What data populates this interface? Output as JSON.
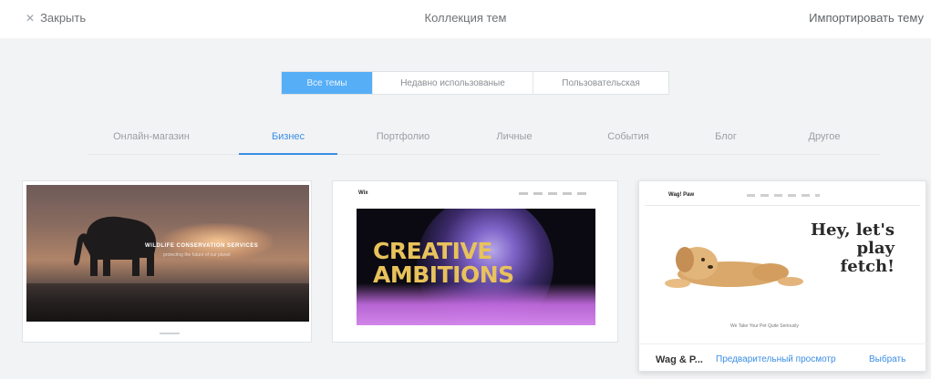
{
  "header": {
    "close_label": "Закрыть",
    "title": "Коллекция тем",
    "import_label": "Импортировать тему"
  },
  "filters": {
    "tabs": [
      "Все темы",
      "Недавно использованые",
      "Пользовательская"
    ],
    "active": "Все темы"
  },
  "categories": {
    "items": [
      "Онлайн-магазин",
      "Бизнес",
      "Портфолио",
      "Личные",
      "События",
      "Блог",
      "Другое"
    ],
    "active": "Бизнес"
  },
  "themes": [
    {
      "preview_title": "WILDLIFE CONSERVATION SERVICES",
      "preview_subtitle": "protecting the future of our planet"
    },
    {
      "preview_logo": "Wix",
      "preview_headline": "CREATIVE AMBITIONS"
    },
    {
      "preview_logo": "Wag! Paw",
      "preview_headline": "Hey, let's play fetch!",
      "preview_caption": "We Take Your Pet Quite Seriously",
      "name": "Wag & P...",
      "preview_label": "Предварительный просмотр",
      "select_label": "Выбрать"
    }
  ],
  "colors": {
    "accent": "#3a8ee6",
    "segment_active": "#56aef7"
  }
}
